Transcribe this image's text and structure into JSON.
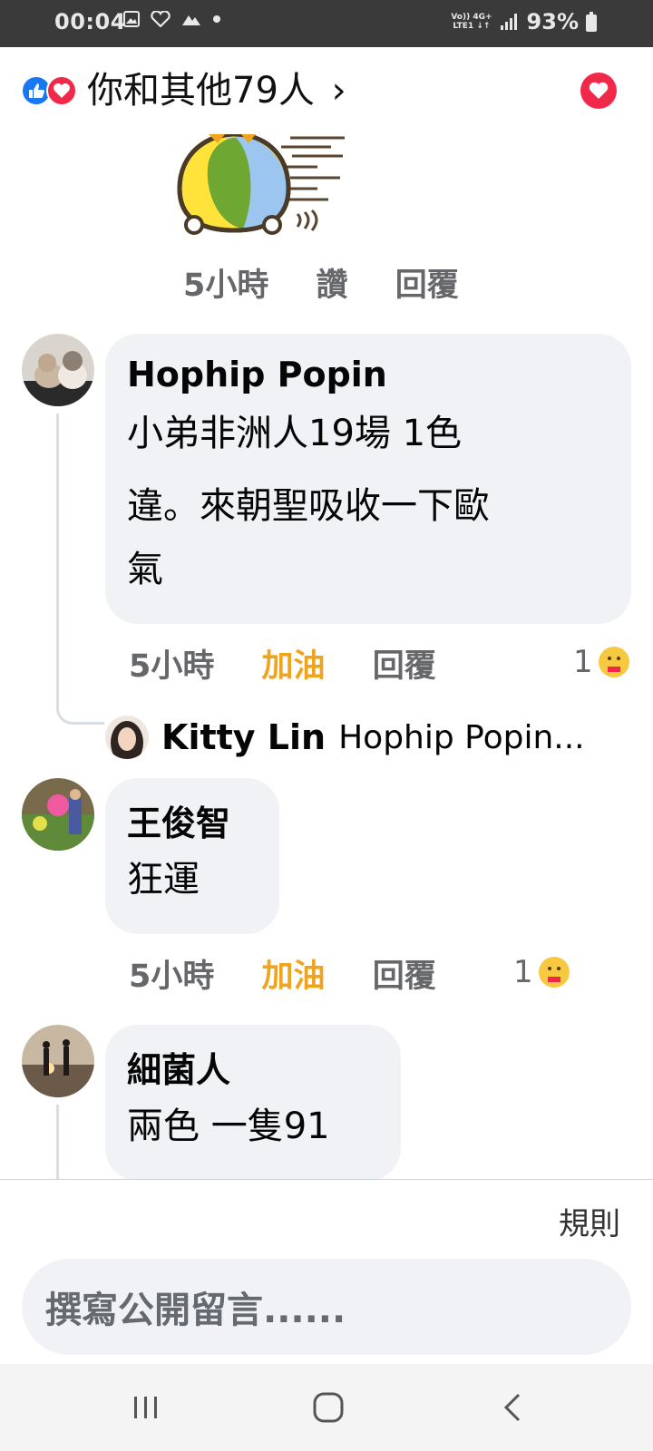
{
  "status_bar": {
    "time": "00:04",
    "battery": "93%",
    "network_top": "Vo)) 4G+",
    "network_bottom": "LTE1 ↓↑",
    "icons": [
      "gallery-icon",
      "heart-pulse-icon",
      "mountain-icon",
      "dot-icon",
      "signal-icon",
      "battery-icon"
    ]
  },
  "header": {
    "reactions_text": "你和其他79人",
    "chevron": "›",
    "reaction_icons": [
      "like-icon",
      "love-icon"
    ]
  },
  "top_meta": {
    "time": "5小時",
    "like": "讚",
    "reply": "回覆"
  },
  "comments": [
    {
      "name": "Hophip Popin",
      "text_lines": [
        "小弟非洲人19場 1色",
        "違。來朝聖吸收一下歐",
        "氣"
      ],
      "time": "5小時",
      "reaction_label": "加油",
      "reply": "回覆",
      "reaction_count": "1",
      "reply_preview": {
        "name": "Kitty Lin",
        "text": "Hophip Popin..."
      }
    },
    {
      "name": "王俊智",
      "text_lines": [
        "狂運"
      ],
      "time": "5小時",
      "reaction_label": "加油",
      "reply": "回覆",
      "reaction_count": "1"
    },
    {
      "name": "細菌人",
      "text_lines": [
        "兩色 一隻91"
      ]
    }
  ],
  "composer": {
    "rules": "規則",
    "placeholder": "撰寫公開留言......"
  },
  "colors": {
    "accent_gold": "#f0a31c",
    "love_red": "#f02849",
    "like_blue": "#1877f2",
    "bubble_bg": "#f0f2f5"
  }
}
